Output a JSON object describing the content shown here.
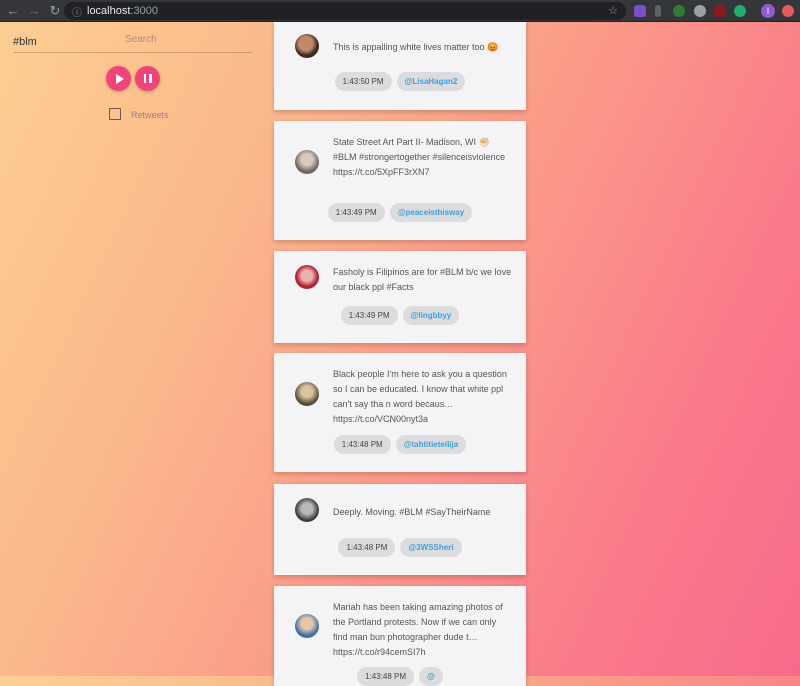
{
  "browser": {
    "url_host": "localhost",
    "url_port": ":3000",
    "profile_initial": "I"
  },
  "controls": {
    "search_value": "#blm",
    "search_label": "Search",
    "retweets_label": "Retweets",
    "accent_color": "#f0447a"
  },
  "tweets": [
    {
      "text": "This is appalling white lives matter too 😡",
      "time": "1:43:50 PM",
      "user": "@LisaHagan2"
    },
    {
      "text": "State Street Art Part II- Madison, WI ✊🏻 #BLM #strongertogether #silenceisviolence https://t.co/5XpFF3rXN7",
      "time": "1:43:49 PM",
      "user": "@peaceisthisway"
    },
    {
      "text": "Fasholy is Filipinos are for #BLM b/c we love our black ppl #Facts",
      "time": "1:43:49 PM",
      "user": "@lingbbyy"
    },
    {
      "text": "Black people I'm here to ask you a question so I can be educated. I know that white ppl can't say tha n word becaus… https://t.co/VCN00nyt3a",
      "time": "1:43:48 PM",
      "user": "@tahtitieteilija"
    },
    {
      "text": "Deeply. Moving. #BLM #SayTheirName",
      "time": "1:43:48 PM",
      "user": "@3WSSheri"
    },
    {
      "text": "Mariah has been taking amazing photos of the Portland protests. Now if we can only find man bun photographer dude t… https://t.co/r94cemSI7h",
      "time": "1:43:48 PM",
      "user": "@"
    }
  ]
}
